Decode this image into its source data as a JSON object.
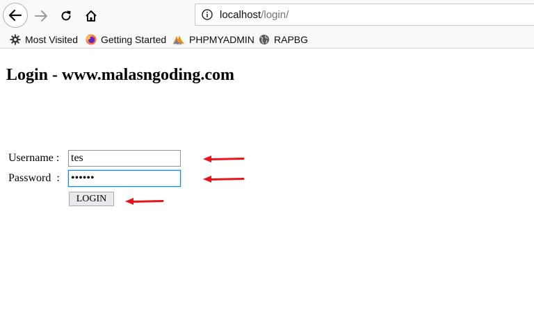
{
  "browser": {
    "url_host": "localhost",
    "url_path": "/login/",
    "bookmarks": [
      {
        "label": "Most Visited",
        "icon": "gear-icon"
      },
      {
        "label": "Getting Started",
        "icon": "firefox-icon"
      },
      {
        "label": "PHPMYADMIN",
        "icon": "phpmyadmin-icon"
      },
      {
        "label": "RAPBG",
        "icon": "globe-icon"
      }
    ]
  },
  "page": {
    "title": "Login - www.malasngoding.com"
  },
  "form": {
    "username_label": "Username : ",
    "password_label": "Password  : ",
    "username_value": "tes",
    "password_value": "••••••",
    "login_button": "LOGIN"
  },
  "colors": {
    "arrow": "#e8151b",
    "focus_border": "#0a84ff"
  }
}
